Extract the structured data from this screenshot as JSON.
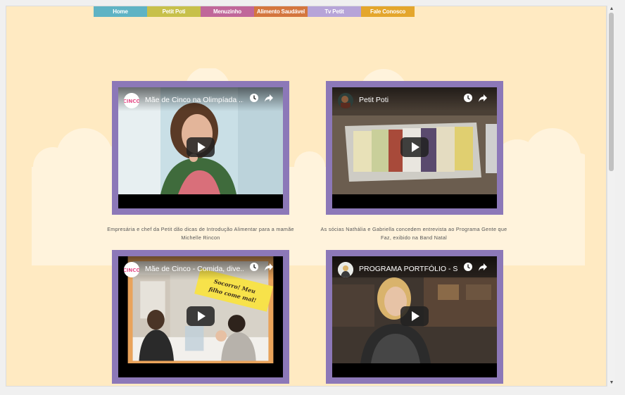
{
  "nav": {
    "items": [
      {
        "label": "Home",
        "color": "#5fb3c4"
      },
      {
        "label": "Petit Poti",
        "color": "#c7c04a"
      },
      {
        "label": "Menuzinho",
        "color": "#c0679a"
      },
      {
        "label": "Alimento Saudável",
        "color": "#d4763e"
      },
      {
        "label": "Tv Petit",
        "color": "#b6a4d8"
      },
      {
        "label": "Fale Conosco",
        "color": "#e4a62c"
      }
    ]
  },
  "colors": {
    "page_background": "#ffeac2",
    "video_frame": "#8c78b8"
  },
  "videos": [
    {
      "title": "Mãe de Cinco na Olimpíada ...",
      "channel_icon": "mae-de-cinco-logo",
      "caption": "Empresária e chef da Petit dão dicas de Introdução Alimentar para a mamãe Michelle Rincon"
    },
    {
      "title": "Petit Poti",
      "channel_icon": "petit-poti-avatar",
      "caption": "As sócias Nathália e Gabriella concedem entrevista ao Programa Gente que Faz, exibido na Band Natal"
    },
    {
      "title": "Mãe de Cinco - Comida, dive...",
      "channel_icon": "mae-de-cinco-logo",
      "overlay_text": "Socorro! Meu filho come mal!",
      "caption": ""
    },
    {
      "title": "PROGRAMA PORTFÓLIO - Sa...",
      "channel_icon": "portfolio-avatar",
      "caption": ""
    }
  ]
}
